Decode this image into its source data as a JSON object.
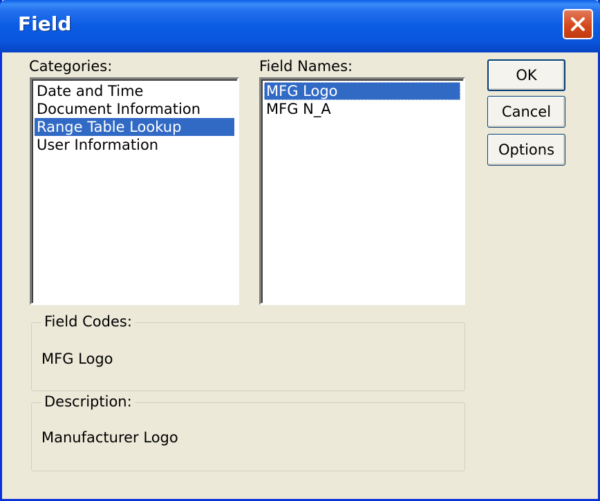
{
  "window": {
    "title": "Field"
  },
  "categories": {
    "label": "Categories:",
    "items": [
      "Date and Time",
      "Document Information",
      "Range Table Lookup",
      "User Information"
    ],
    "selected": "Range Table Lookup"
  },
  "field_names": {
    "label": "Field Names:",
    "items": [
      "MFG Logo",
      "MFG N_A"
    ],
    "selected": "MFG Logo"
  },
  "buttons": {
    "ok": "OK",
    "cancel": "Cancel",
    "options": "Options"
  },
  "field_codes": {
    "label": "Field Codes:",
    "value": "MFG Logo"
  },
  "description": {
    "label": "Description:",
    "value": "Manufacturer Logo"
  }
}
